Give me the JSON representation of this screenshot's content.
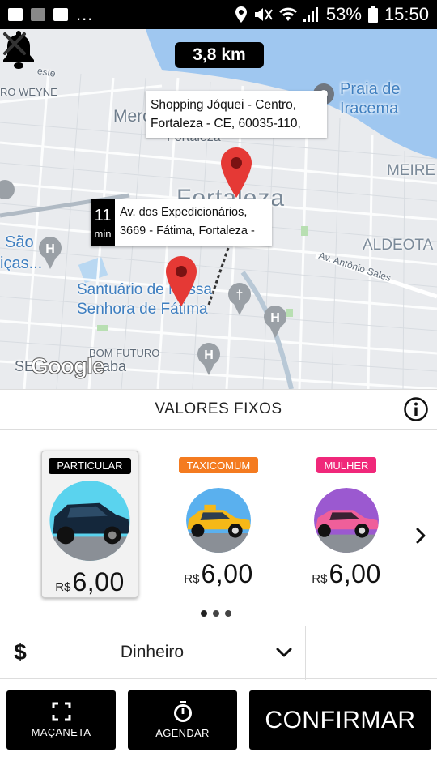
{
  "status_bar": {
    "battery": "53%",
    "time": "15:50",
    "overflow": "..."
  },
  "map": {
    "distance": "3,8 km",
    "labels": {
      "weyne": "RO WEYNE",
      "mer": "Merc",
      "fortaleza_small": "Fortaleza",
      "fortaleza_big": "Fortaleza",
      "praia": "Praia de\nIracema",
      "meireles": "MEIRE",
      "aldeota": "ALDEOTA",
      "sao": "São",
      "cas": "iças...",
      "santuario": "Santuário de Nossa\nSenhora de Fátima",
      "antonio_sales": "Av. Antônio Sales",
      "bom_futuro": "BOM FUTURO",
      "se": "SE",
      "gaba": "aba",
      "este": "este"
    },
    "destination_callout": "Shopping Jóquei - Centro, Fortaleza - CE, 60035-110,",
    "origin_callout": {
      "eta_value": "11",
      "eta_unit": "min",
      "address": "Av. dos Expedicionários, 3669 - Fátima, Fortaleza -"
    },
    "attribution": "Google"
  },
  "fixed_values": {
    "title": "VALORES FIXOS"
  },
  "categories": [
    {
      "name": "PARTICULAR",
      "currency": "R$",
      "price": "6,00",
      "badge_color": "#000000",
      "car_color": "#1c3b55",
      "selected": true
    },
    {
      "name": "TAXICOMUM",
      "currency": "R$",
      "price": "6,00",
      "badge_color": "#f47b20",
      "car_color": "#f5b817",
      "selected": false
    },
    {
      "name": "MULHER",
      "currency": "R$",
      "price": "6,00",
      "badge_color": "#f0287a",
      "car_color": "#ef5f9a",
      "selected": false
    }
  ],
  "payment": {
    "symbol": "$",
    "method": "Dinheiro"
  },
  "actions": {
    "macaneta": "MAÇANETA",
    "agendar": "AGENDAR",
    "confirmar": "CONFIRMAR"
  },
  "colors": {
    "pin": "#e53935",
    "water": "#9fc7f0",
    "accent": "#000000"
  }
}
